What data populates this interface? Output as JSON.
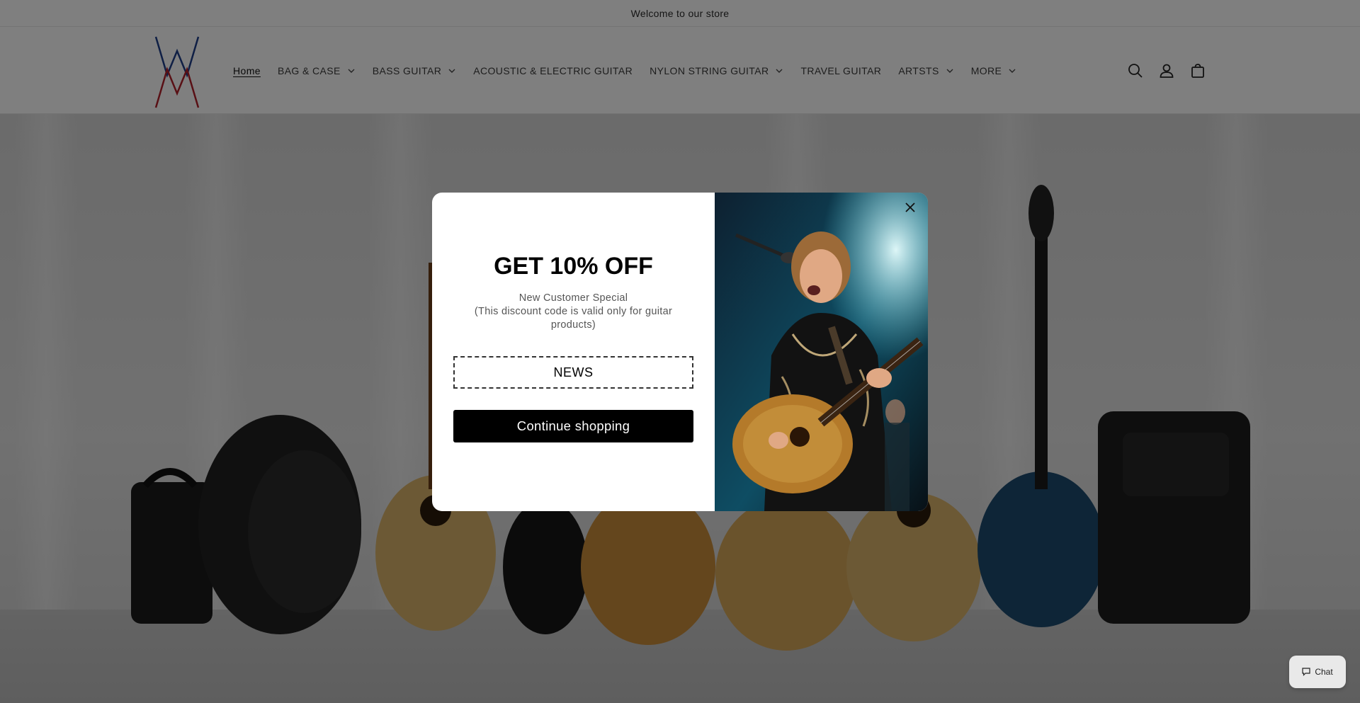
{
  "announcement": {
    "text": "Welcome to our store"
  },
  "header": {
    "logo": {
      "name": "brand-logo"
    },
    "nav": [
      {
        "label": "Home",
        "active": true,
        "dropdown": false
      },
      {
        "label": "BAG & CASE",
        "active": false,
        "dropdown": true
      },
      {
        "label": "BASS GUITAR",
        "active": false,
        "dropdown": true
      },
      {
        "label": "ACOUSTIC & ELECTRIC GUITAR",
        "active": false,
        "dropdown": false
      },
      {
        "label": "NYLON STRING GUITAR",
        "active": false,
        "dropdown": true
      },
      {
        "label": "TRAVEL GUITAR",
        "active": false,
        "dropdown": false
      },
      {
        "label": "ARTSTS",
        "active": false,
        "dropdown": true
      },
      {
        "label": "MORE",
        "active": false,
        "dropdown": true
      }
    ],
    "icons": [
      "search-icon",
      "account-icon",
      "cart-icon"
    ]
  },
  "popup": {
    "title": "GET 10% OFF",
    "subtitle_line1": "New Customer Special",
    "subtitle_line2": "(This discount code is valid only for guitar products)",
    "code": "NEWS",
    "cta_label": "Continue shopping",
    "close_icon": "close-icon",
    "image": "guitarist-performing-photo"
  },
  "chat": {
    "label": "Chat"
  },
  "colors": {
    "overlay": "rgba(0,0,0,0.5)",
    "cta_bg": "#000000",
    "logo_blue": "#1f3f8a",
    "logo_red": "#b3202a"
  }
}
